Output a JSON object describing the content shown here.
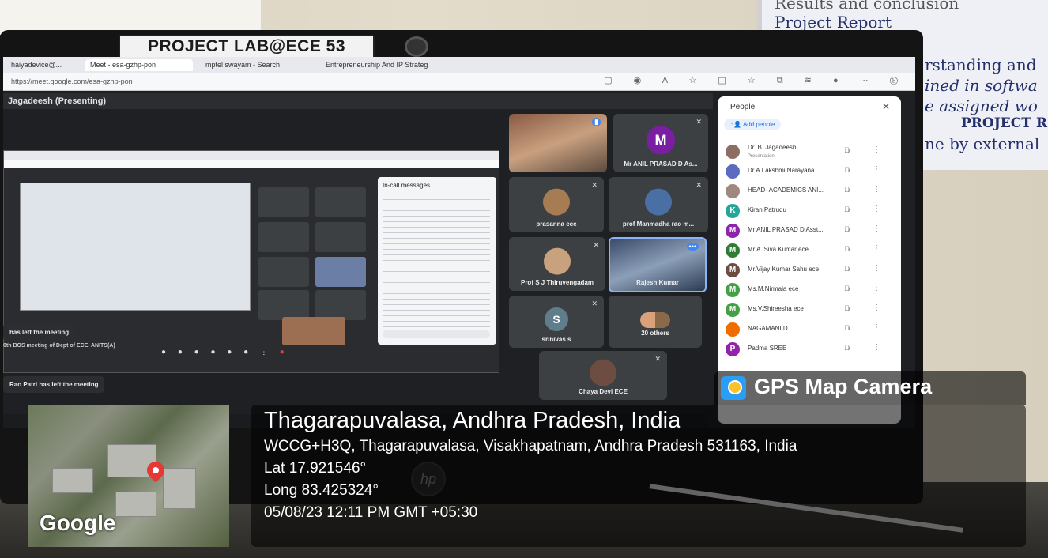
{
  "monitor_label": "PROJECT LAB@ECE 53",
  "poster_lines": [
    "Results and conclusion",
    "Project Report",
    "rstanding and",
    "ined in softwa",
    "e assigned wo",
    "PROJECT R",
    "ne by external"
  ],
  "browser": {
    "tabs": [
      "haiyadevice@...",
      "Meet - esa-gzhp-pon",
      "mptel swayam - Search",
      "Entrepreneurship And IP Strateg"
    ],
    "url": "https://meet.google.com/esa-gzhp-pon"
  },
  "meet": {
    "presenting_label": "Jagadeesh (Presenting)",
    "tiles": [
      {
        "name": "",
        "avatar": "",
        "type": "video"
      },
      {
        "name": "Mr ANIL PRASAD D As...",
        "avatar": "M",
        "type": "initial",
        "color": "#7b1fa2"
      },
      {
        "name": "prasanna ece",
        "avatar": "",
        "type": "photo"
      },
      {
        "name": "prof Manmadha rao m...",
        "avatar": "",
        "type": "photo"
      },
      {
        "name": "Prof S J Thiruvengadam",
        "avatar": "",
        "type": "photo"
      },
      {
        "name": "Rajesh Kumar",
        "avatar": "",
        "type": "video2"
      },
      {
        "name": "srinivas s",
        "avatar": "S",
        "type": "initial",
        "color": "#607d8b"
      },
      {
        "name": "20 others",
        "avatar": "",
        "type": "group"
      },
      {
        "name": "Chaya Devi ECE",
        "avatar": "",
        "type": "photo"
      }
    ],
    "chat_title": "In-call messages",
    "toast_left": "has left the meeting",
    "toast_bottom": "Rao Patri has left the meeting",
    "meeting_name": "0th BOS meeting of Dept of ECE, ANITS(A)"
  },
  "people_panel": {
    "title": "People",
    "add_people": "Add people",
    "members": [
      {
        "name": "Dr. B. Jagadeesh",
        "sub": "Presentation",
        "initial": "",
        "color": "#8d6e63"
      },
      {
        "name": "Dr.A.Lakshmi Narayana",
        "initial": "",
        "color": "#5c6bc0"
      },
      {
        "name": "HEAD- ACADEMICS ANI...",
        "initial": "",
        "color": "#a1887f"
      },
      {
        "name": "Kiran Patrudu",
        "initial": "K",
        "color": "#26a69a"
      },
      {
        "name": "Mr ANIL PRASAD D Asst...",
        "initial": "M",
        "color": "#8e24aa"
      },
      {
        "name": "Mr.A .Siva Kumar ece",
        "initial": "M",
        "color": "#2e7d32"
      },
      {
        "name": "Mr.Vijay Kumar Sahu ece",
        "initial": "M",
        "color": "#6d4c41"
      },
      {
        "name": "Ms.M.Nirmala ece",
        "initial": "M",
        "color": "#43a047"
      },
      {
        "name": "Ms.V.Shireesha ece",
        "initial": "M",
        "color": "#43a047"
      },
      {
        "name": "NAGAMANI D",
        "initial": "",
        "color": "#ef6c00"
      },
      {
        "name": "Padma SREE",
        "initial": "P",
        "color": "#8e24aa"
      }
    ]
  },
  "gps": {
    "badge_title": "GPS Map Camera",
    "place": "Thagarapuvalasa, Andhra Pradesh, India",
    "address": "WCCG+H3Q, Thagarapuvalasa, Visakhapatnam, Andhra Pradesh 531163, India",
    "lat": "Lat 17.921546°",
    "long": "Long 83.425324°",
    "datetime": "05/08/23 12:11 PM GMT +05:30",
    "map_brand": "Google"
  },
  "monitor_brand": "hp"
}
